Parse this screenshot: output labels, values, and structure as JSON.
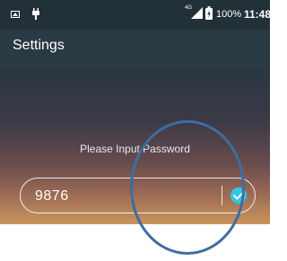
{
  "status_bar": {
    "network_label": "4G",
    "battery_percent": "100%",
    "time": "11:48",
    "icons": [
      "image-icon",
      "plug-icon",
      "signal-icon",
      "battery-icon"
    ]
  },
  "app_bar": {
    "title": "Settings"
  },
  "password_dialog": {
    "prompt": "Please Input Password",
    "input_value": "9876",
    "confirm_icon": "check-icon"
  },
  "colors": {
    "status_bar_bg": "#223038",
    "app_bar_bg": "#2a3a42",
    "confirm_accent": "#31c7e8",
    "annotation_ring": "#3c6ea1"
  }
}
